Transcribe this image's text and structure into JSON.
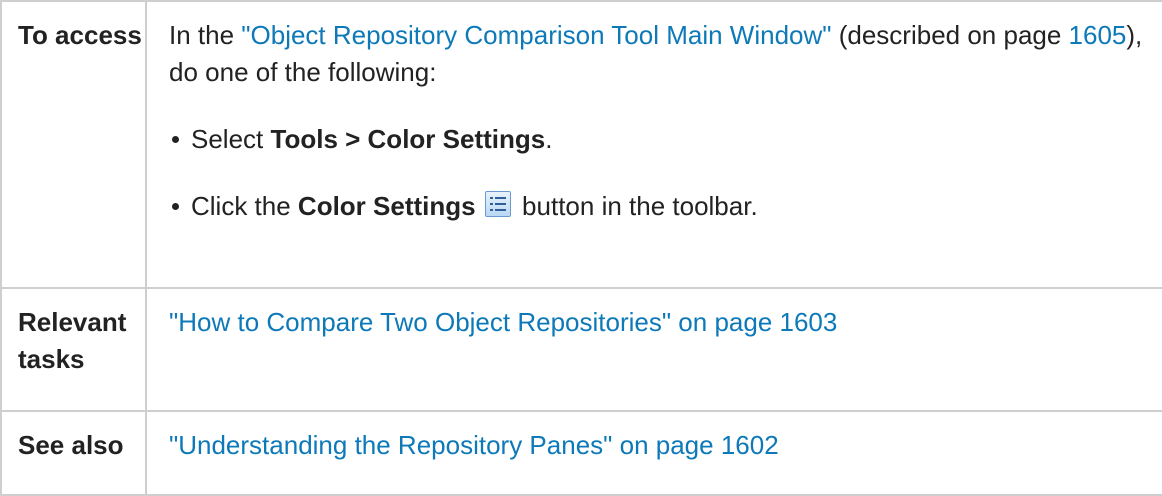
{
  "rows": [
    {
      "header": "To access",
      "intro_prefix": "In the ",
      "intro_link": "\"Object Repository Comparison Tool Main Window\"",
      "intro_middle": " (described on page ",
      "intro_page_link": "1605",
      "intro_suffix": "), do one of the following:",
      "step1": {
        "prefix": "Select ",
        "bold": "Tools > Color Settings",
        "suffix": "."
      },
      "step2": {
        "prefix": "Click the ",
        "bold": "Color Settings",
        "suffix": " button in the toolbar.",
        "icon": "color-settings-icon"
      }
    },
    {
      "header": "Relevant tasks",
      "link": "\"How to Compare Two Object Repositories\" on page 1603"
    },
    {
      "header": "See also",
      "link": "\"Understanding the Repository Panes\" on page 1602"
    }
  ],
  "colors": {
    "link": "#0d79b8",
    "border": "#cfcfcf",
    "text": "#222222"
  }
}
